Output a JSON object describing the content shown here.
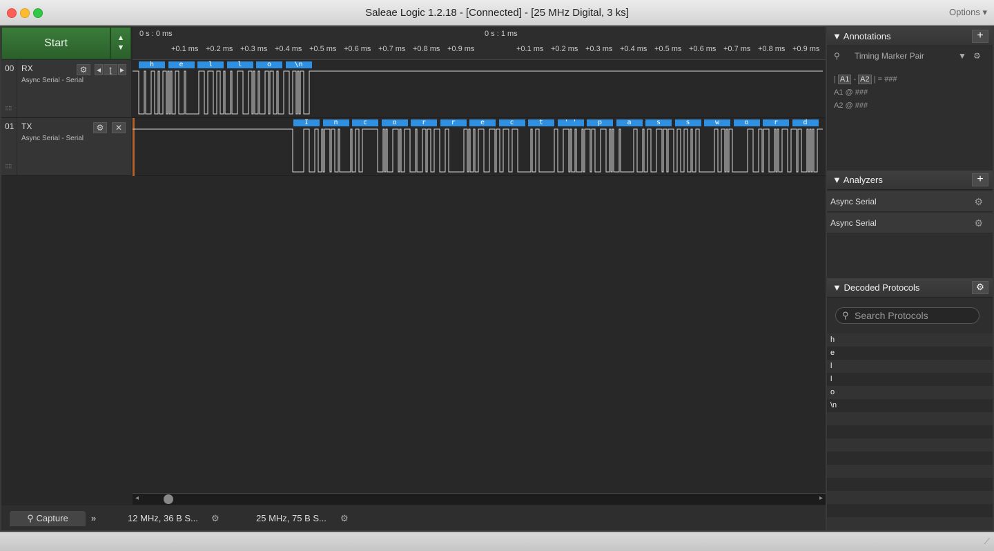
{
  "window": {
    "title": "Saleae Logic 1.2.18 - [Connected] - [25 MHz Digital, 3 ks]",
    "options": "Options"
  },
  "toolbar": {
    "start_label": "Start"
  },
  "ruler": {
    "top": [
      "0 s : 0 ms",
      "0 s : 1 ms"
    ],
    "ticks": [
      "+0.1 ms",
      "+0.2 ms",
      "+0.3 ms",
      "+0.4 ms",
      "+0.5 ms",
      "+0.6 ms",
      "+0.7 ms",
      "+0.8 ms",
      "+0.9 ms"
    ]
  },
  "channels": [
    {
      "num": "00",
      "name": "RX",
      "sub": "Async Serial - Serial",
      "frames": [
        "h",
        "e",
        "l",
        "l",
        "o",
        "\\n"
      ]
    },
    {
      "num": "01",
      "name": "TX",
      "sub": "Async Serial - Serial",
      "frames": [
        "I",
        "n",
        "c",
        "o",
        "r",
        "r",
        "e",
        "c",
        "t",
        "' '",
        "p",
        "a",
        "s",
        "s",
        "w",
        "o",
        "r",
        "d"
      ]
    }
  ],
  "tabs": {
    "capture": "Capture",
    "session1": "12 MHz, 36 B S...",
    "session2": "25 MHz, 75 B S..."
  },
  "annotations": {
    "title": "Annotations",
    "marker": "Timing Marker Pair",
    "a1": "A1",
    "a2": "A2",
    "formula_tail": "| = ###",
    "a1_line": "A1  @  ###",
    "a2_line": "A2  @  ###"
  },
  "analyzers": {
    "title": "Analyzers",
    "items": [
      "Async Serial",
      "Async Serial"
    ]
  },
  "decoded": {
    "title": "Decoded Protocols",
    "search_placeholder": "Search Protocols",
    "rows": [
      "h",
      "e",
      "l",
      "l",
      "o",
      "\\n"
    ]
  },
  "colors": {
    "frame": "#2f8fe0",
    "start": "#3a7c3a"
  }
}
